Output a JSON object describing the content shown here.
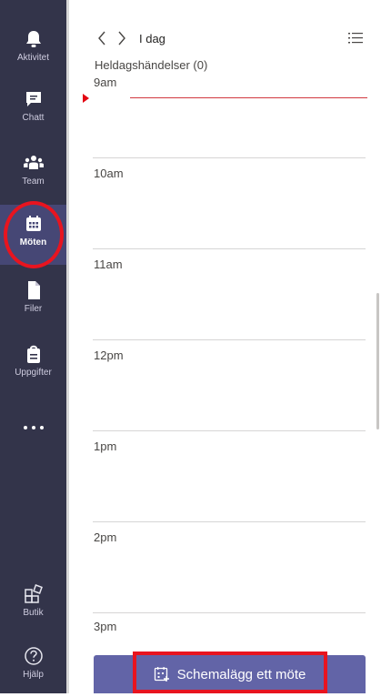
{
  "rail": {
    "items": [
      {
        "label": "Aktivitet",
        "icon": "bell-icon"
      },
      {
        "label": "Chatt",
        "icon": "chat-icon"
      },
      {
        "label": "Team",
        "icon": "team-icon"
      },
      {
        "label": "Möten",
        "icon": "calendar-icon",
        "active": true
      },
      {
        "label": "Filer",
        "icon": "file-icon"
      },
      {
        "label": "Uppgifter",
        "icon": "tasks-icon"
      },
      {
        "label": "Butik",
        "icon": "store-icon"
      },
      {
        "label": "Hjälp",
        "icon": "help-icon"
      }
    ],
    "more_icon": "more-dots-icon",
    "colors": {
      "background": "#33344a",
      "active": "#464775",
      "highlight": "#e8141f"
    }
  },
  "header": {
    "today_label": "I dag",
    "allday_label": "Heldagshändelser (0)"
  },
  "timeline": {
    "hours": [
      "9am",
      "10am",
      "11am",
      "12pm",
      "1pm",
      "2pm",
      "3pm"
    ],
    "now_color": "#e30613"
  },
  "footer": {
    "schedule_label": "Schemalägg ett möte",
    "button_color": "#6264a7"
  }
}
